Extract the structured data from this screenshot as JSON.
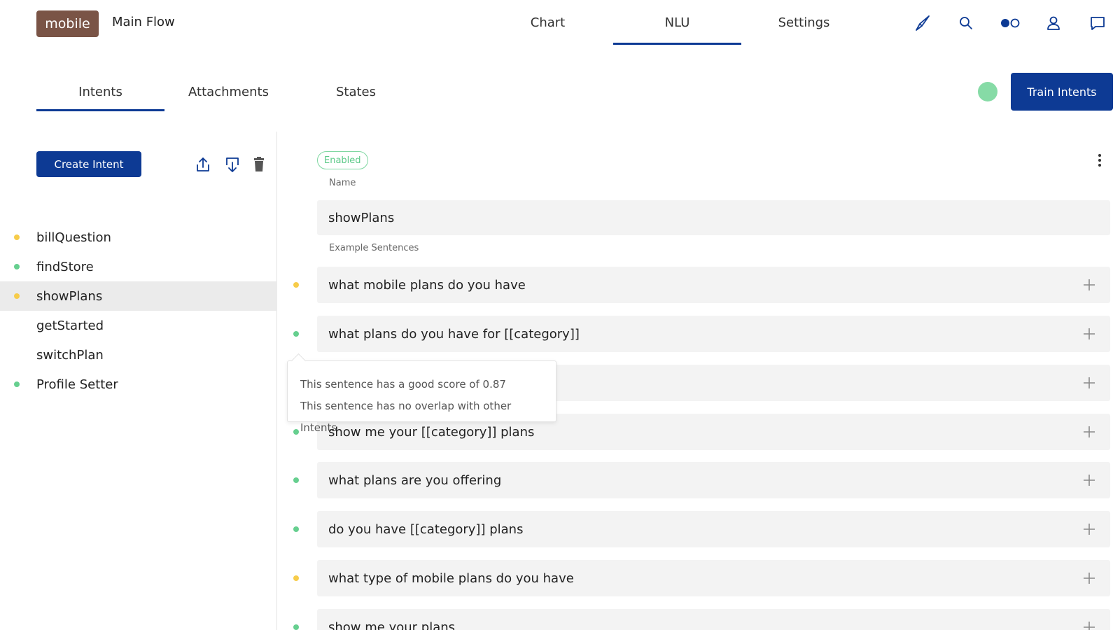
{
  "header": {
    "brand": "mobile",
    "flow_title": "Main Flow",
    "tabs": [
      {
        "label": "Chart",
        "active": false
      },
      {
        "label": "NLU",
        "active": true
      },
      {
        "label": "Settings",
        "active": false
      }
    ],
    "icons": [
      "compass-needle-icon",
      "search-icon",
      "toggle-icon",
      "user-icon",
      "chat-icon"
    ]
  },
  "subnav": {
    "tabs": [
      {
        "label": "Intents",
        "active": true
      },
      {
        "label": "Attachments",
        "active": false
      },
      {
        "label": "States",
        "active": false
      }
    ],
    "train_status_color": "#86dba6",
    "train_button": "Train Intents"
  },
  "sidebar": {
    "create_button": "Create Intent",
    "icons": [
      "upload-icon",
      "download-icon",
      "trash-icon"
    ],
    "intents": [
      {
        "name": "billQuestion",
        "status": "#f7cc4a",
        "selected": false
      },
      {
        "name": "findStore",
        "status": "#66cf8f",
        "selected": false
      },
      {
        "name": "showPlans",
        "status": "#f7cc4a",
        "selected": true
      },
      {
        "name": "getStarted",
        "status": "",
        "selected": false
      },
      {
        "name": "switchPlan",
        "status": "",
        "selected": false
      },
      {
        "name": "Profile Setter",
        "status": "#66cf8f",
        "selected": false
      }
    ]
  },
  "intent": {
    "enabled_label": "Enabled",
    "name_label": "Name",
    "name_value": "showPlans",
    "examples_label": "Example Sentences",
    "sentences": [
      {
        "text": "what mobile plans do you have",
        "status": "#f7cc4a"
      },
      {
        "text": "what plans do you have for [[category]]",
        "status": "#66cf8f"
      },
      {
        "text": "",
        "status": ""
      },
      {
        "text": "show me your [[category]] plans",
        "status": "#66cf8f"
      },
      {
        "text": "what plans are you offering",
        "status": "#66cf8f"
      },
      {
        "text": "do you have [[category]] plans",
        "status": "#66cf8f"
      },
      {
        "text": "what type of mobile plans do you have",
        "status": "#f7cc4a"
      },
      {
        "text": "show me your plans",
        "status": "#66cf8f"
      }
    ]
  },
  "tooltip": {
    "line1": "This sentence has a good score of 0.87",
    "line2": "This sentence has no overlap with other Intents"
  },
  "colors": {
    "primary": "#0d3a94",
    "brand": "#7a5446",
    "good": "#66cf8f",
    "warn": "#f7cc4a"
  }
}
